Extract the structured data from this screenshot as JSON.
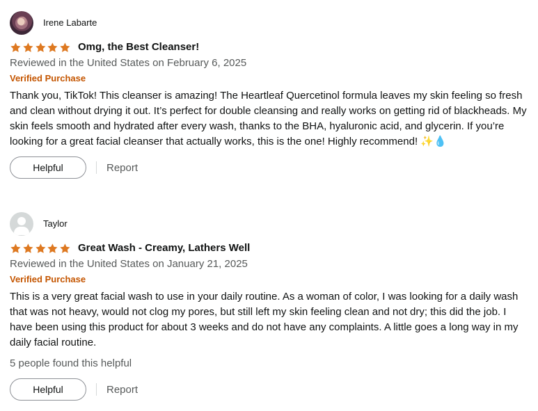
{
  "reviews": [
    {
      "reviewer": "Irene Labarte",
      "avatar": "profile-photo",
      "rating": 5,
      "rating_max": 5,
      "title": "Omg, the Best Cleanser!",
      "date": "Reviewed in the United States on February 6, 2025",
      "verified": "Verified Purchase",
      "body": "Thank you, TikTok!    This cleanser is amazing! The Heartleaf Quercetinol formula leaves my skin feeling so fresh and clean without drying it out. It’s perfect for double cleansing and really works on getting rid of blackheads. My skin feels smooth and hydrated after every wash, thanks to the BHA, hyaluronic acid, and glycerin. If you’re looking for a great facial cleanser that actually works, this is the one! Highly recommend! ✨💧",
      "helpful_label": "Helpful",
      "report_label": "Report"
    },
    {
      "reviewer": "Taylor",
      "avatar": "default-user-icon",
      "rating": 5,
      "rating_max": 5,
      "title": "Great Wash - Creamy, Lathers Well",
      "date": "Reviewed in the United States on January 21, 2025",
      "verified": "Verified Purchase",
      "body": "This is a very great facial wash to use in your daily routine. As a woman of color, I was looking for a daily wash that was not heavy, would not clog my pores, but still left my skin feeling clean and not dry; this did the job. I have been using this product for about 3 weeks and do not have any complaints. A little goes a long way in my daily facial routine.",
      "helpful_count": "5 people found this helpful",
      "helpful_label": "Helpful",
      "report_label": "Report"
    }
  ],
  "colors": {
    "star": "#de7921",
    "verified": "#c45500",
    "muted_text": "#565959",
    "primary_text": "#0f1111"
  }
}
